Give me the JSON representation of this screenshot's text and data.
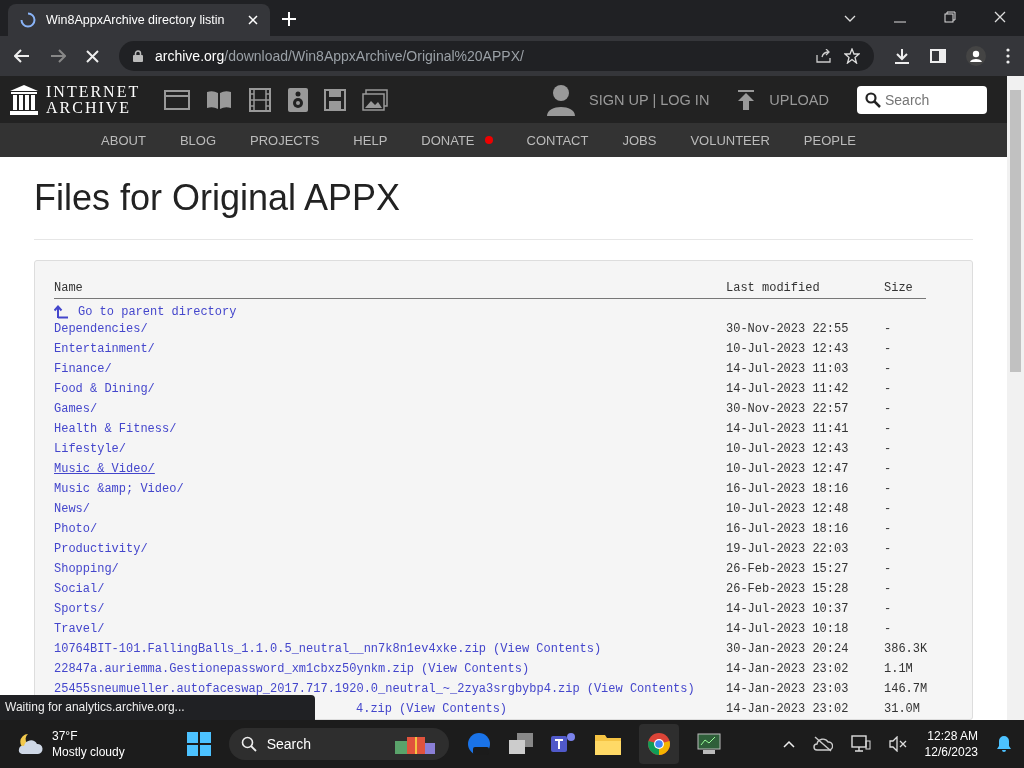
{
  "browser": {
    "tab_title": "Win8AppxArchive directory listin",
    "url_domain": "archive.org",
    "url_path": "/download/Win8AppxArchive/Original%20APPX/"
  },
  "site_header": {
    "logo_top": "INTERNET",
    "logo_bottom": "ARCHIVE",
    "account": "SIGN UP | LOG IN",
    "upload": "UPLOAD",
    "search": {
      "placeholder": "Search"
    }
  },
  "nav": [
    {
      "label": "ABOUT",
      "dot": false
    },
    {
      "label": "BLOG",
      "dot": false
    },
    {
      "label": "PROJECTS",
      "dot": false
    },
    {
      "label": "HELP",
      "dot": false
    },
    {
      "label": "DONATE",
      "dot": true
    },
    {
      "label": "CONTACT",
      "dot": false
    },
    {
      "label": "JOBS",
      "dot": false
    },
    {
      "label": "VOLUNTEER",
      "dot": false
    },
    {
      "label": "PEOPLE",
      "dot": false
    }
  ],
  "heading": "Files for Original APPX",
  "listing": {
    "columns": [
      "Name",
      "Last modified",
      "Size"
    ],
    "parent": "Go to parent directory",
    "rows": [
      {
        "name": "Dependencies/",
        "modified": "30-Nov-2023 22:55",
        "size": "-",
        "hovered": false
      },
      {
        "name": "Entertainment/",
        "modified": "10-Jul-2023 12:43",
        "size": "-",
        "hovered": false
      },
      {
        "name": "Finance/",
        "modified": "14-Jul-2023 11:03",
        "size": "-",
        "hovered": false
      },
      {
        "name": "Food & Dining/",
        "modified": "14-Jul-2023 11:42",
        "size": "-",
        "hovered": false
      },
      {
        "name": "Games/",
        "modified": "30-Nov-2023 22:57",
        "size": "-",
        "hovered": false
      },
      {
        "name": "Health & Fitness/",
        "modified": "14-Jul-2023 11:41",
        "size": "-",
        "hovered": false
      },
      {
        "name": "Lifestyle/",
        "modified": "10-Jul-2023 12:43",
        "size": "-",
        "hovered": false
      },
      {
        "name": "Music & Video/",
        "modified": "10-Jul-2023 12:47",
        "size": "-",
        "hovered": true
      },
      {
        "name": "Music &amp; Video/",
        "modified": "16-Jul-2023 18:16",
        "size": "-",
        "hovered": false
      },
      {
        "name": "News/",
        "modified": "10-Jul-2023 12:48",
        "size": "-",
        "hovered": false
      },
      {
        "name": "Photo/",
        "modified": "16-Jul-2023 18:16",
        "size": "-",
        "hovered": false
      },
      {
        "name": "Productivity/",
        "modified": "19-Jul-2023 22:03",
        "size": "-",
        "hovered": false
      },
      {
        "name": "Shopping/",
        "modified": "26-Feb-2023 15:27",
        "size": "-",
        "hovered": false
      },
      {
        "name": "Social/",
        "modified": "26-Feb-2023 15:28",
        "size": "-",
        "hovered": false
      },
      {
        "name": "Sports/",
        "modified": "14-Jul-2023 10:37",
        "size": "-",
        "hovered": false
      },
      {
        "name": "Travel/",
        "modified": "14-Jul-2023 10:18",
        "size": "-",
        "hovered": false
      },
      {
        "name": "10764BIT-101.FallingBalls_1.1.0.5_neutral__nn7k8n1ev4xke.zip",
        "view": "(View Contents)",
        "modified": "30-Jan-2023 20:24",
        "size": "386.3K",
        "hovered": false
      },
      {
        "name": "22847a.auriemma.Gestionepassword_xm1cbxz50ynkm.zip",
        "view": "(View Contents)",
        "modified": "14-Jan-2023 23:02",
        "size": "1.1M",
        "hovered": false
      },
      {
        "name": "25455sneumueller.autofaceswap_2017.717.1920.0_neutral_~_2zya3srgbybp4.zip",
        "view": "(View Contents)",
        "modified": "14-Jan-2023 23:03",
        "size": "146.7M",
        "hovered": false
      },
      {
        "name": "4.zip",
        "view": "(View Contents)",
        "modified": "14-Jan-2023 23:02",
        "size": "31.0M",
        "hovered": false,
        "covered": true
      }
    ]
  },
  "status_tooltip": "Waiting for analytics.archive.org...",
  "taskbar": {
    "temperature": "37°F",
    "weather": "Mostly cloudy",
    "search": "Search",
    "time": "12:28 AM",
    "date": "12/6/2023"
  }
}
